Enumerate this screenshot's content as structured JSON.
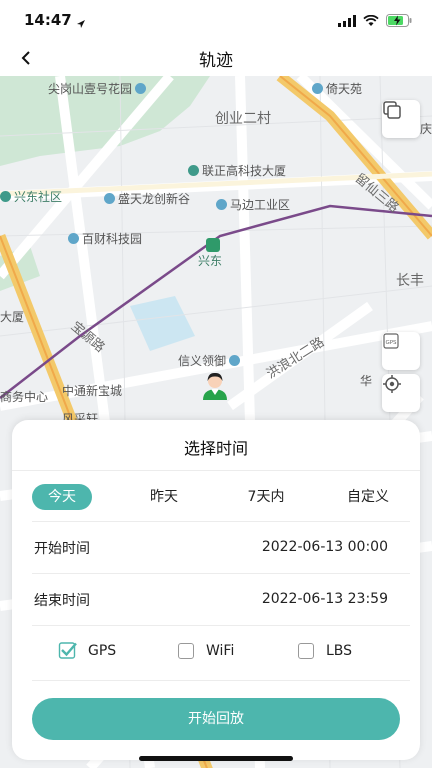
{
  "status": {
    "time": "14:47"
  },
  "nav": {
    "title": "轨迹"
  },
  "map": {
    "labels": {
      "a": "尖岗山壹号花园",
      "b": "倚天苑",
      "c": "创业二村",
      "d": "庆",
      "e": "联正高科技大厦",
      "f": "留仙三路",
      "g": "兴东社区",
      "h": "盛天龙创新谷",
      "i": "马边工业区",
      "j": "百财科技园",
      "k": "兴东",
      "l": "长丰",
      "m": "大厦",
      "n": "宝源路",
      "o": "洪浪北二路",
      "p": "信义领御",
      "q": "华",
      "r": "商务中心",
      "s": "中通新宝城",
      "t": "风采轩"
    }
  },
  "sheet": {
    "title": "选择时间",
    "tabs": [
      "今天",
      "昨天",
      "7天内",
      "自定义"
    ],
    "start_label": "开始时间",
    "start_value": "2022-06-13 00:00",
    "end_label": "结束时间",
    "end_value": "2022-06-13 23:59",
    "options": [
      {
        "label": "GPS",
        "checked": true
      },
      {
        "label": "WiFi",
        "checked": false
      },
      {
        "label": "LBS",
        "checked": false
      }
    ],
    "button": "开始回放"
  },
  "colors": {
    "accent": "#4db6ad",
    "rail": "#7a4a8a",
    "major_road": "#f3c96a",
    "park": "#cfe7d5"
  }
}
